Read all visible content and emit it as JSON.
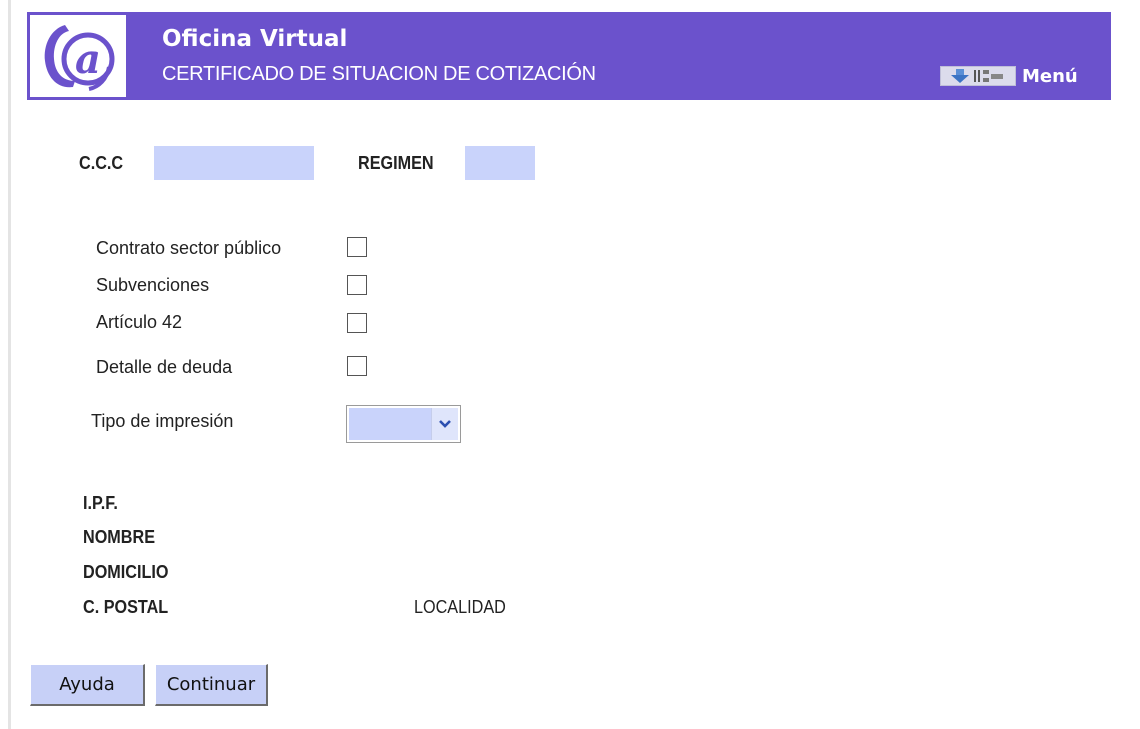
{
  "header": {
    "title": "Oficina Virtual",
    "subtitle": "CERTIFICADO DE SITUACION DE COTIZACIÓN",
    "logo_icon": "at-sign-logo-icon",
    "menu": {
      "label": "Menú",
      "icons": [
        "download-arrow-icon",
        "sitemap-icon"
      ]
    },
    "colors": {
      "bar": "#6b52cc",
      "field": "#c9d3fb"
    }
  },
  "form": {
    "ccc": {
      "label": "C.C.C",
      "value": ""
    },
    "regimen": {
      "label": "REGIMEN",
      "value": ""
    },
    "checkboxes": [
      {
        "label": "Contrato sector público",
        "checked": false
      },
      {
        "label": "Subvenciones",
        "checked": false
      },
      {
        "label": "Artículo 42",
        "checked": false
      },
      {
        "label": "Detalle de deuda",
        "checked": false
      }
    ],
    "tipo_impresion": {
      "label": "Tipo de impresión",
      "selected": ""
    }
  },
  "info": {
    "ipf": "I.P.F.",
    "nombre": "NOMBRE",
    "domicilio": "DOMICILIO",
    "c_postal": "C. POSTAL",
    "localidad": "LOCALIDAD"
  },
  "buttons": {
    "ayuda": "Ayuda",
    "continuar": "Continuar"
  }
}
